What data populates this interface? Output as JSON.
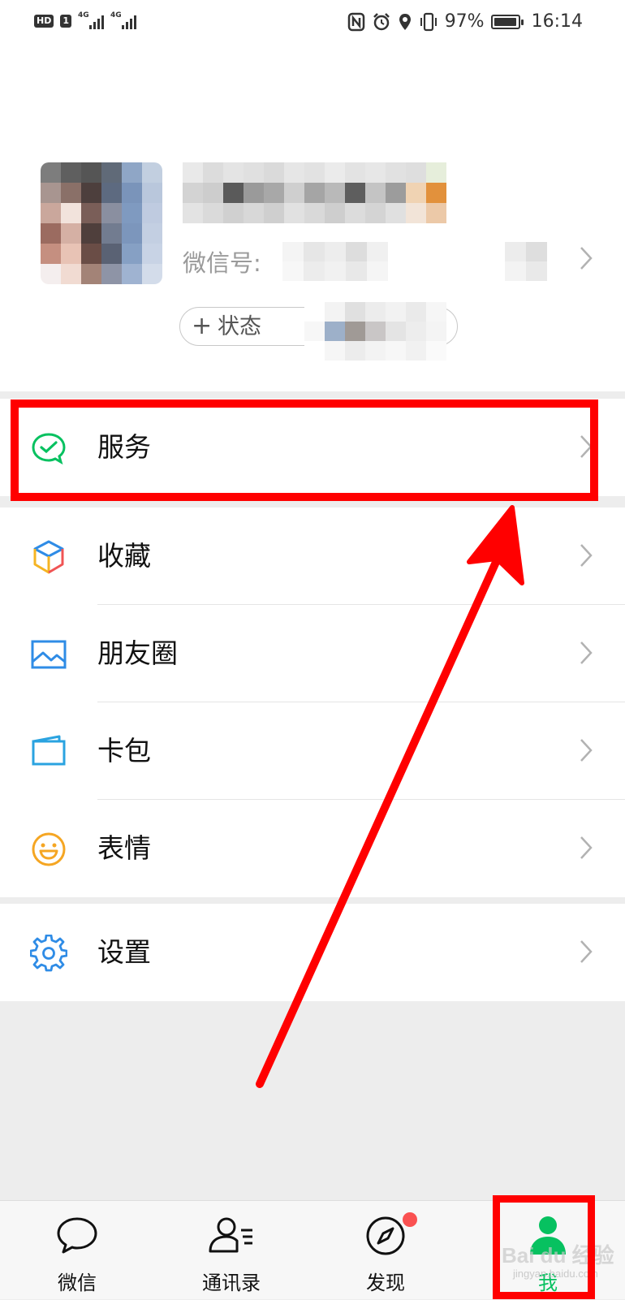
{
  "status_bar": {
    "hd": "HD",
    "sim1": "1",
    "net1": "4G",
    "net2": "4G",
    "battery_percent": "97%",
    "battery_level": 0.97,
    "time": "16:14",
    "icons": [
      "nfc-icon",
      "alarm-icon",
      "location-icon",
      "vibrate-icon",
      "battery-icon"
    ]
  },
  "profile": {
    "wechat_id_label": "微信号:",
    "status_label": "状态",
    "status_plus": "+",
    "avatar_pixels": [
      "#7d7d7d",
      "#5f5f5f",
      "#555555",
      "#606a78",
      "#8fa6c6",
      "#c2cfe0",
      "#a89590",
      "#8a7068",
      "#4d3f3d",
      "#5d6a80",
      "#7a94ba",
      "#b9c7dc",
      "#caa79c",
      "#f2e3dc",
      "#7a5e58",
      "#8a8fa0",
      "#7f9ac0",
      "#bfcbe0",
      "#9b6b60",
      "#d5b0a4",
      "#4f3f3c",
      "#727c90",
      "#7c96bc",
      "#c3cfe2",
      "#c58f80",
      "#e8c3b5",
      "#6a4d46",
      "#5a6274",
      "#86a0c4",
      "#c8d3e5",
      "#f4eeee",
      "#f1dbd2",
      "#a38377",
      "#8e94a6",
      "#9fb3d1",
      "#d3dcea"
    ],
    "name_pixels": [
      "#e9e9e9",
      "#dcdcdc",
      "#e4e4e4",
      "#e0e0e0",
      "#dadada",
      "#e6e6e6",
      "#e2e2e2",
      "#ebebeb",
      "#e3e3e3",
      "#e7e7e7",
      "#e1e1e1",
      "#dedede",
      "#e6eedb",
      "#d3d3d3",
      "#cdcdcd",
      "#5a5a5a",
      "#9a9a9a",
      "#a8a8a8",
      "#cfcfcf",
      "#a5a5a5",
      "#b9b9b9",
      "#5e5e5e",
      "#c4c4c4",
      "#9c9c9c",
      "#f0d3b3",
      "#e2913c",
      "#e3e3e3",
      "#dadada",
      "#d0d0d0",
      "#d8d8d8",
      "#cfcfcf",
      "#e1e1e1",
      "#d9d9d9",
      "#cecece",
      "#dcdcdc",
      "#d4d4d4",
      "#e0e0e0",
      "#f2e4d8",
      "#ecc9a8"
    ],
    "id_pixels": [
      "#f4f4f4",
      "#e6e6e6",
      "#ededed",
      "#dddddd",
      "#f0f0f0",
      "#f7f7f7",
      "#ececec",
      "#f1f1f1",
      "#e8e8e8",
      "#f5f5f5"
    ],
    "id2_pixels": [
      "#ececec",
      "#dedede",
      "#f3f3f3",
      "#e9e9e9"
    ],
    "status_pixels": [
      "#ffffff",
      "#f3f3f3",
      "#e0e0e0",
      "#ececec",
      "#f2f2f2",
      "#eaeaea",
      "#f6f6f6",
      "#f7f7f7",
      "#9db0c9",
      "#a09a96",
      "#c9c6c6",
      "#e4e4e4",
      "#ededed",
      "#f4f4f4",
      "#ffffff",
      "#f6f6f6",
      "#ececec",
      "#f3f3f3",
      "#f7f7f7",
      "#f1f1f1",
      "#fafafa"
    ]
  },
  "menu": {
    "groups": [
      [
        {
          "label": "服务",
          "icon": "services-icon"
        }
      ],
      [
        {
          "label": "收藏",
          "icon": "favorites-icon"
        },
        {
          "label": "朋友圈",
          "icon": "moments-icon"
        },
        {
          "label": "卡包",
          "icon": "cards-icon"
        },
        {
          "label": "表情",
          "icon": "stickers-icon"
        }
      ],
      [
        {
          "label": "设置",
          "icon": "settings-icon"
        }
      ]
    ]
  },
  "tabbar": {
    "tabs": [
      {
        "label": "微信",
        "icon": "chats-icon",
        "active": false
      },
      {
        "label": "通讯录",
        "icon": "contacts-icon",
        "active": false
      },
      {
        "label": "发现",
        "icon": "discover-icon",
        "active": false,
        "badge": true
      },
      {
        "label": "我",
        "icon": "me-icon",
        "active": true
      }
    ],
    "watermark": "Bai du 经验",
    "watermark_sub": "jingyan.baidu.com"
  },
  "colors": {
    "accent": "#07c160",
    "highlight": "#ff0000",
    "badge": "#fa5151"
  }
}
